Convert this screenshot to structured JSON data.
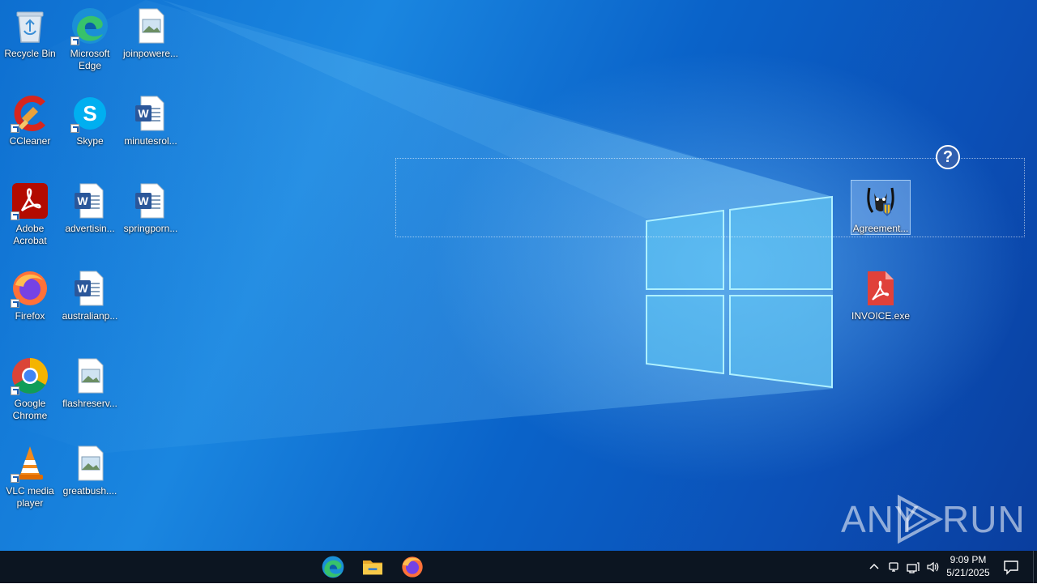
{
  "desktop": {
    "icons": [
      {
        "label": "Recycle Bin",
        "icon": "recycle-bin-icon"
      },
      {
        "label": "Microsoft Edge",
        "icon": "edge-icon"
      },
      {
        "label": "joinpowere...",
        "icon": "image-file-icon"
      },
      {
        "label": "CCleaner",
        "icon": "ccleaner-icon"
      },
      {
        "label": "Skype",
        "icon": "skype-icon"
      },
      {
        "label": "minutesrol...",
        "icon": "word-doc-icon"
      },
      {
        "label": "Adobe Acrobat",
        "icon": "acrobat-icon"
      },
      {
        "label": "advertisin...",
        "icon": "word-doc-icon"
      },
      {
        "label": "springporn...",
        "icon": "word-doc-icon"
      },
      {
        "label": "Firefox",
        "icon": "firefox-icon"
      },
      {
        "label": "australianp...",
        "icon": "word-doc-icon"
      },
      {
        "label": "Google Chrome",
        "icon": "chrome-icon"
      },
      {
        "label": "flashreserv...",
        "icon": "image-file-icon"
      },
      {
        "label": "VLC media player",
        "icon": "vlc-icon"
      },
      {
        "label": "greatbush....",
        "icon": "image-file-icon"
      },
      {
        "label": "Agreement...",
        "icon": "agreement-exe-icon"
      },
      {
        "label": "INVOICE.exe",
        "icon": "invoice-exe-icon"
      }
    ],
    "help_glyph": "?",
    "watermark": {
      "left": "ANY",
      "right": "RUN"
    }
  },
  "taskbar": {
    "apps": [
      "edge-icon",
      "file-explorer-icon",
      "firefox-icon"
    ],
    "time": "9:09 PM",
    "date": "5/21/2025"
  },
  "colors": {
    "desktop_blue": "#0e6fd0",
    "taskbar": "#0c1521"
  }
}
